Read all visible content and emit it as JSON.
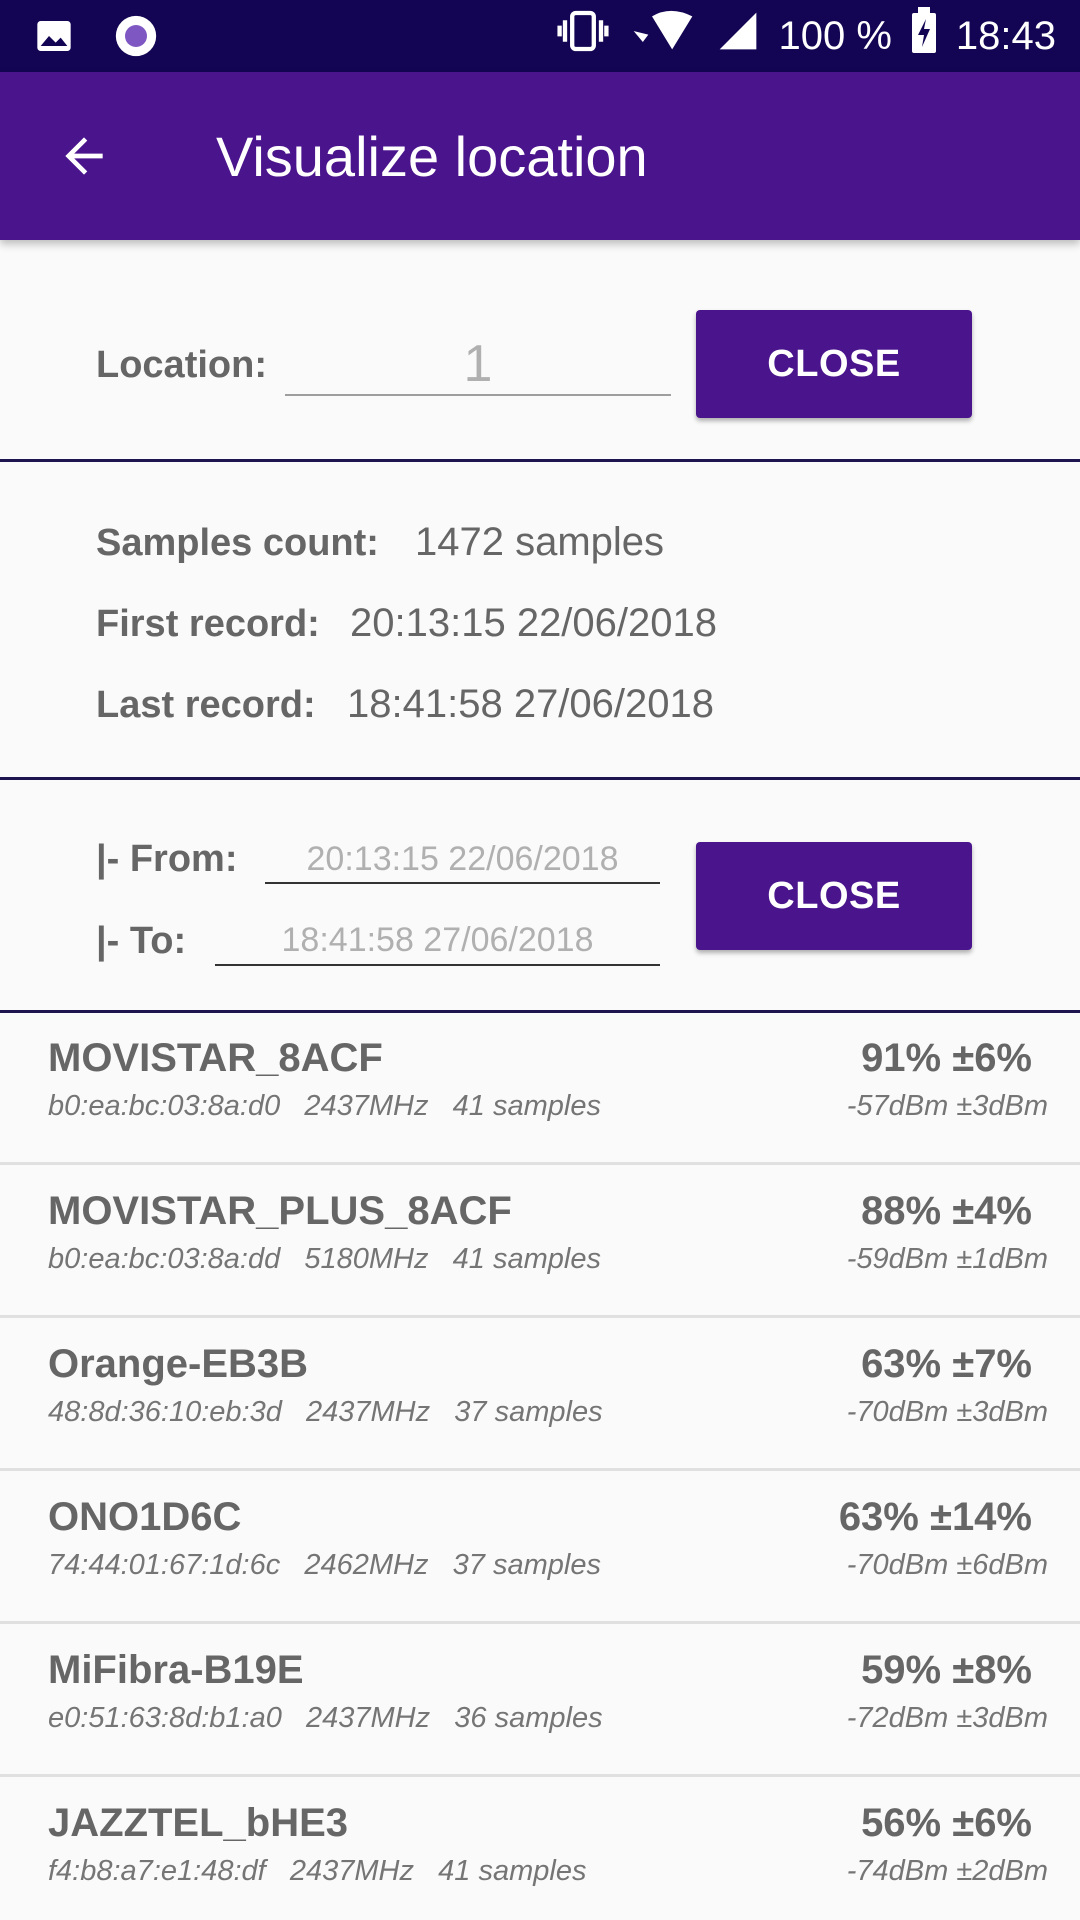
{
  "status_bar": {
    "battery": "100 %",
    "time": "18:43",
    "icons": [
      "image-icon",
      "circle-app-icon",
      "vibrate-icon",
      "wifi-icon",
      "cell-signal-icon",
      "battery-charging-icon"
    ]
  },
  "app_bar": {
    "title": "Visualize location",
    "back_icon": "arrow-back-icon"
  },
  "location": {
    "label": "Location:",
    "value": "1",
    "close_label": "CLOSE"
  },
  "stats": {
    "samples_label": "Samples count:",
    "samples_value": "1472 samples",
    "first_label": "First record:",
    "first_value": "20:13:15 22/06/2018",
    "last_label": "Last record:",
    "last_value": "18:41:58 27/06/2018"
  },
  "range": {
    "from_label": "|- From:",
    "from_value": "20:13:15 22/06/2018",
    "to_label": "|- To:",
    "to_value": "18:41:58 27/06/2018",
    "close_label": "CLOSE"
  },
  "networks": [
    {
      "name": "MOVISTAR_8ACF",
      "mac": "b0:ea:bc:03:8a:d0",
      "freq": "2437MHz",
      "samples": "41 samples",
      "quality": "91% ±6%",
      "signal": "-57dBm ±3dBm"
    },
    {
      "name": "MOVISTAR_PLUS_8ACF",
      "mac": "b0:ea:bc:03:8a:dd",
      "freq": "5180MHz",
      "samples": "41 samples",
      "quality": "88% ±4%",
      "signal": "-59dBm ±1dBm"
    },
    {
      "name": "Orange-EB3B",
      "mac": "48:8d:36:10:eb:3d",
      "freq": "2437MHz",
      "samples": "37 samples",
      "quality": "63% ±7%",
      "signal": "-70dBm ±3dBm"
    },
    {
      "name": "ONO1D6C",
      "mac": "74:44:01:67:1d:6c",
      "freq": "2462MHz",
      "samples": "37 samples",
      "quality": "63% ±14%",
      "signal": "-70dBm ±6dBm"
    },
    {
      "name": "MiFibra-B19E",
      "mac": "e0:51:63:8d:b1:a0",
      "freq": "2437MHz",
      "samples": "36 samples",
      "quality": "59% ±8%",
      "signal": "-72dBm ±3dBm"
    },
    {
      "name": "JAZZTEL_bHE3",
      "mac": "f4:b8:a7:e1:48:df",
      "freq": "2437MHz",
      "samples": "41 samples",
      "quality": "56% ±6%",
      "signal": "-74dBm ±2dBm"
    }
  ]
}
